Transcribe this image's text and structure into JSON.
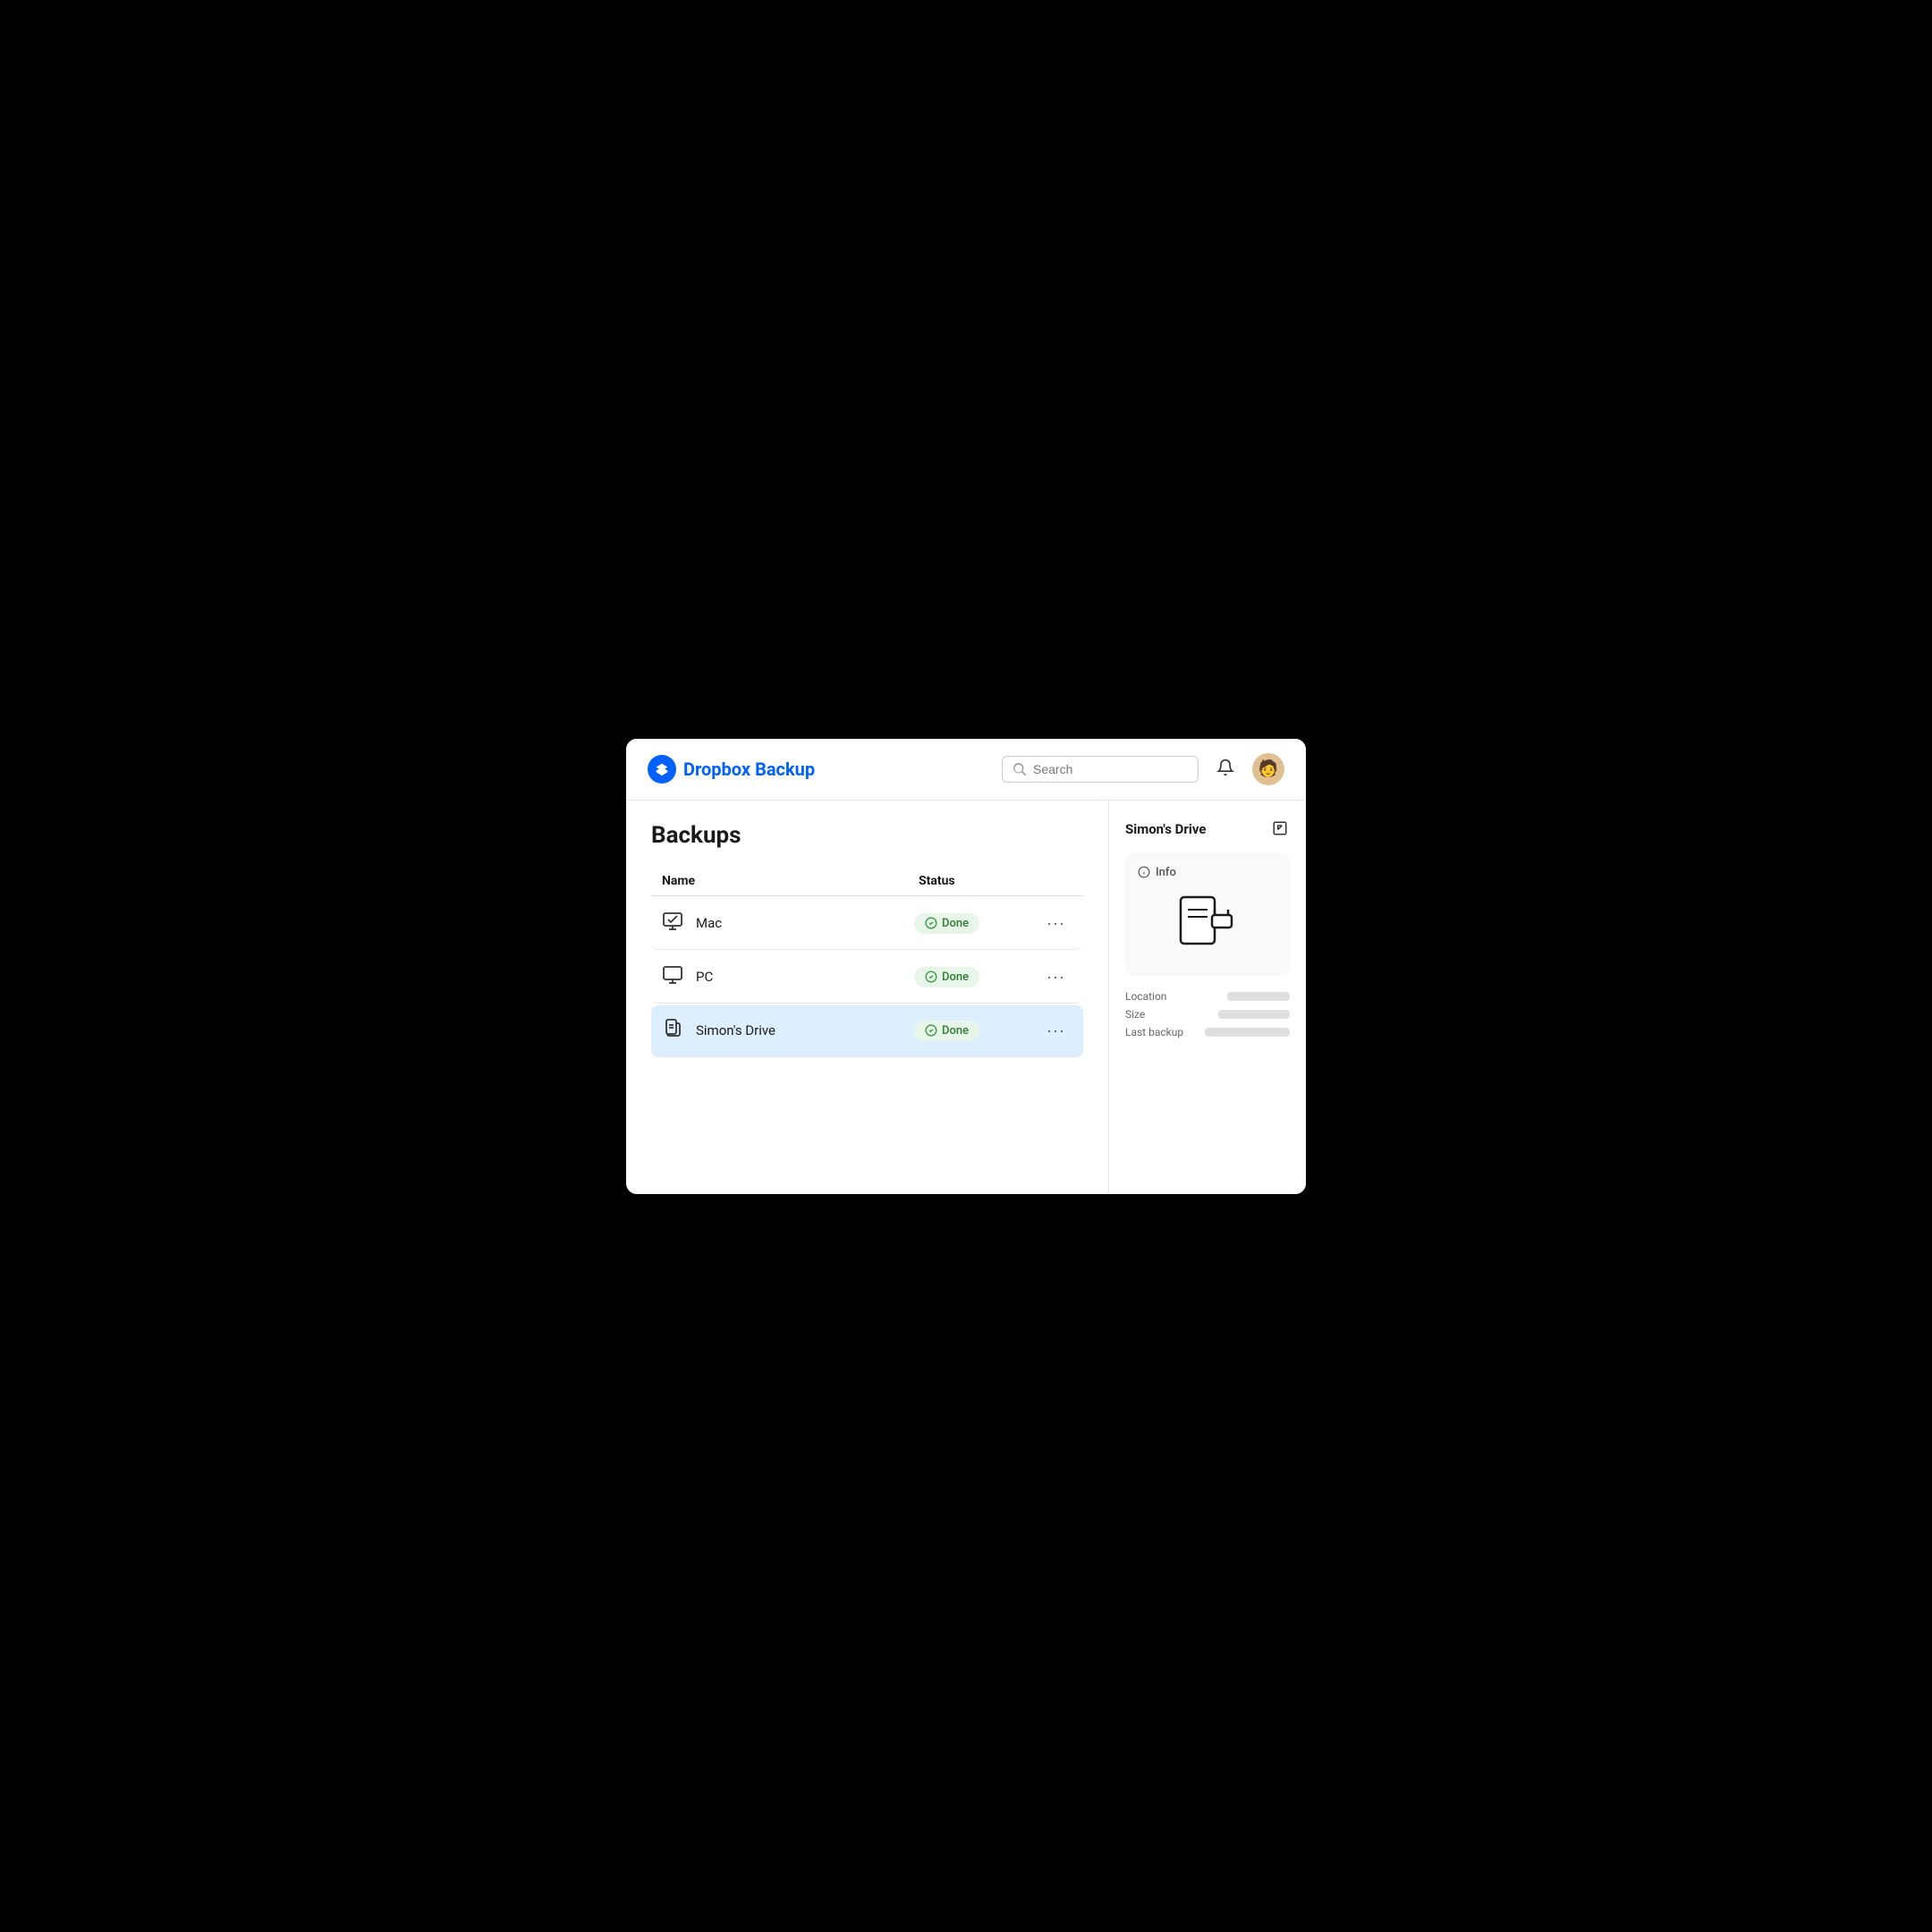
{
  "header": {
    "logo_brand": "Dropbox",
    "logo_product": "Backup",
    "search_placeholder": "Search"
  },
  "page": {
    "title": "Backups"
  },
  "table": {
    "col_name": "Name",
    "col_status": "Status"
  },
  "rows": [
    {
      "id": "mac",
      "name": "Mac",
      "status": "Done",
      "selected": false,
      "icon": "computer"
    },
    {
      "id": "pc",
      "name": "PC",
      "status": "Done",
      "selected": false,
      "icon": "computer"
    },
    {
      "id": "simons-drive",
      "name": "Simon's Drive",
      "status": "Done",
      "selected": true,
      "icon": "drive"
    }
  ],
  "side_panel": {
    "title": "Simon's Drive",
    "info_label": "Info",
    "details": {
      "location_label": "Location",
      "size_label": "Size",
      "last_backup_label": "Last backup"
    }
  }
}
